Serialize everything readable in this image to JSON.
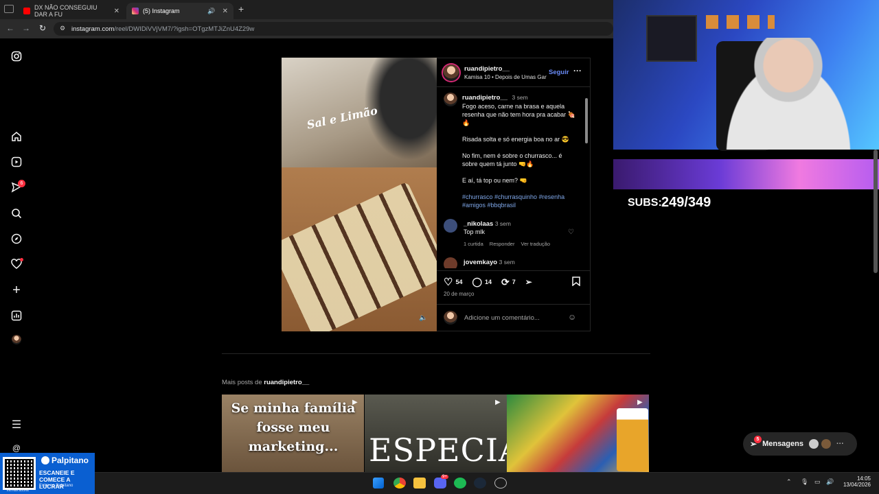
{
  "browser": {
    "tabs": [
      {
        "label": "DX NÃO CONSEGUIU DAR A FU",
        "favicon_color": "#ff0000"
      },
      {
        "label": "(5) Instagram",
        "favicon_color": "#d62976"
      }
    ],
    "url_host": "instagram.com",
    "url_path": "/reel/DWIDiVVjVM7/?igsh=OTgzMTJiZnU4Z29w"
  },
  "sidebar": {
    "icons": [
      "instagram-logo-icon",
      "home-icon",
      "reels-icon",
      "direct-icon",
      "search-icon",
      "explore-icon",
      "heart-icon",
      "create-icon",
      "dashboard-icon",
      "profile-avatar",
      "menu-icon",
      "threads-icon"
    ],
    "direct_badge": "6"
  },
  "video": {
    "overlay_text": "Sal e Limão"
  },
  "post": {
    "username": "ruandipietro__",
    "audio": "Kamisa 10 • Depois de Umas Gar...",
    "follow_label": "Seguir",
    "caption_user": "ruandipietro__",
    "caption_time": "3 sem",
    "caption_lines": [
      "Fogo aceso, carne na brasa e aquela resenha que não tem hora pra acabar 🍖🔥",
      "Risada solta e só energia boa no ar 😎",
      "No fim, nem é sobre o churrasco... é sobre quem tá junto 🤜🔥",
      "E aí, tá top ou nem? 🤜"
    ],
    "hashtags": "#churrasco #churrasquinho #resenha #amigos #bbqbrasil",
    "comments": [
      {
        "user": "_nikolaas",
        "time": "3 sem",
        "text": "Top mlk",
        "likes": "1 curtida",
        "reply": "Responder",
        "translate": "Ver tradução"
      },
      {
        "user": "jovemkayo",
        "time": "3 sem",
        "text": "",
        "likes": "",
        "reply": "",
        "translate": ""
      }
    ],
    "likes": "54",
    "comments_count": "14",
    "reposts": "7",
    "date": "20 de março",
    "add_comment_placeholder": "Adicione um comentário..."
  },
  "more_posts": {
    "prefix": "Mais posts de ",
    "user": "ruandipietro__",
    "items": [
      {
        "text": "Se minha família fosse meu marketing..."
      },
      {
        "text": "ESPECIAL"
      },
      {
        "text": ""
      }
    ]
  },
  "stream": {
    "subs_label": "SUBS:",
    "subs_value": "249/349"
  },
  "messages": {
    "label": "Mensagens",
    "badge": "5"
  },
  "ad": {
    "brand": "Palpitano",
    "line1": "ESCANEIE E",
    "line2": "COMECE A LUCRAR",
    "line3": "Entre no Palpitano",
    "cta": "ENTRAR AGORA"
  },
  "taskbar": {
    "time": "14:05",
    "date": "13/04/2026",
    "discord_badge": "9+"
  }
}
